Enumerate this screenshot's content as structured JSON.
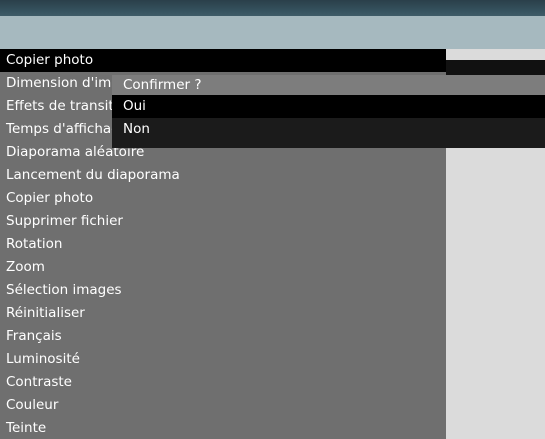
{
  "menu": {
    "items": [
      {
        "label": "Copier photo"
      },
      {
        "label": "Dimension d'image"
      },
      {
        "label": "Effets de transition"
      },
      {
        "label": "Temps d'affichage"
      },
      {
        "label": "Diaporama aléatoire"
      },
      {
        "label": "Lancement du diaporama"
      },
      {
        "label": "Copier photo"
      },
      {
        "label": "Supprimer fichier"
      },
      {
        "label": "Rotation"
      },
      {
        "label": "Zoom"
      },
      {
        "label": "Sélection images"
      },
      {
        "label": "Réinitialiser"
      },
      {
        "label": "Français"
      },
      {
        "label": "Luminosité"
      },
      {
        "label": "Contraste"
      },
      {
        "label": "Couleur"
      },
      {
        "label": "Teinte"
      }
    ]
  },
  "dialog": {
    "title": "Confirmer ?",
    "options": [
      {
        "label": "Oui"
      },
      {
        "label": "Non"
      }
    ]
  },
  "colors": {
    "top_bar": "#34505c",
    "header_band": "#a6b9bf",
    "menu_bg": "#6f6f6f",
    "selected_bg": "#000000",
    "dialog_title_bg": "#7d7d7d",
    "dialog_bg": "#1b1b1b",
    "right_area": "#dbdbdb"
  }
}
